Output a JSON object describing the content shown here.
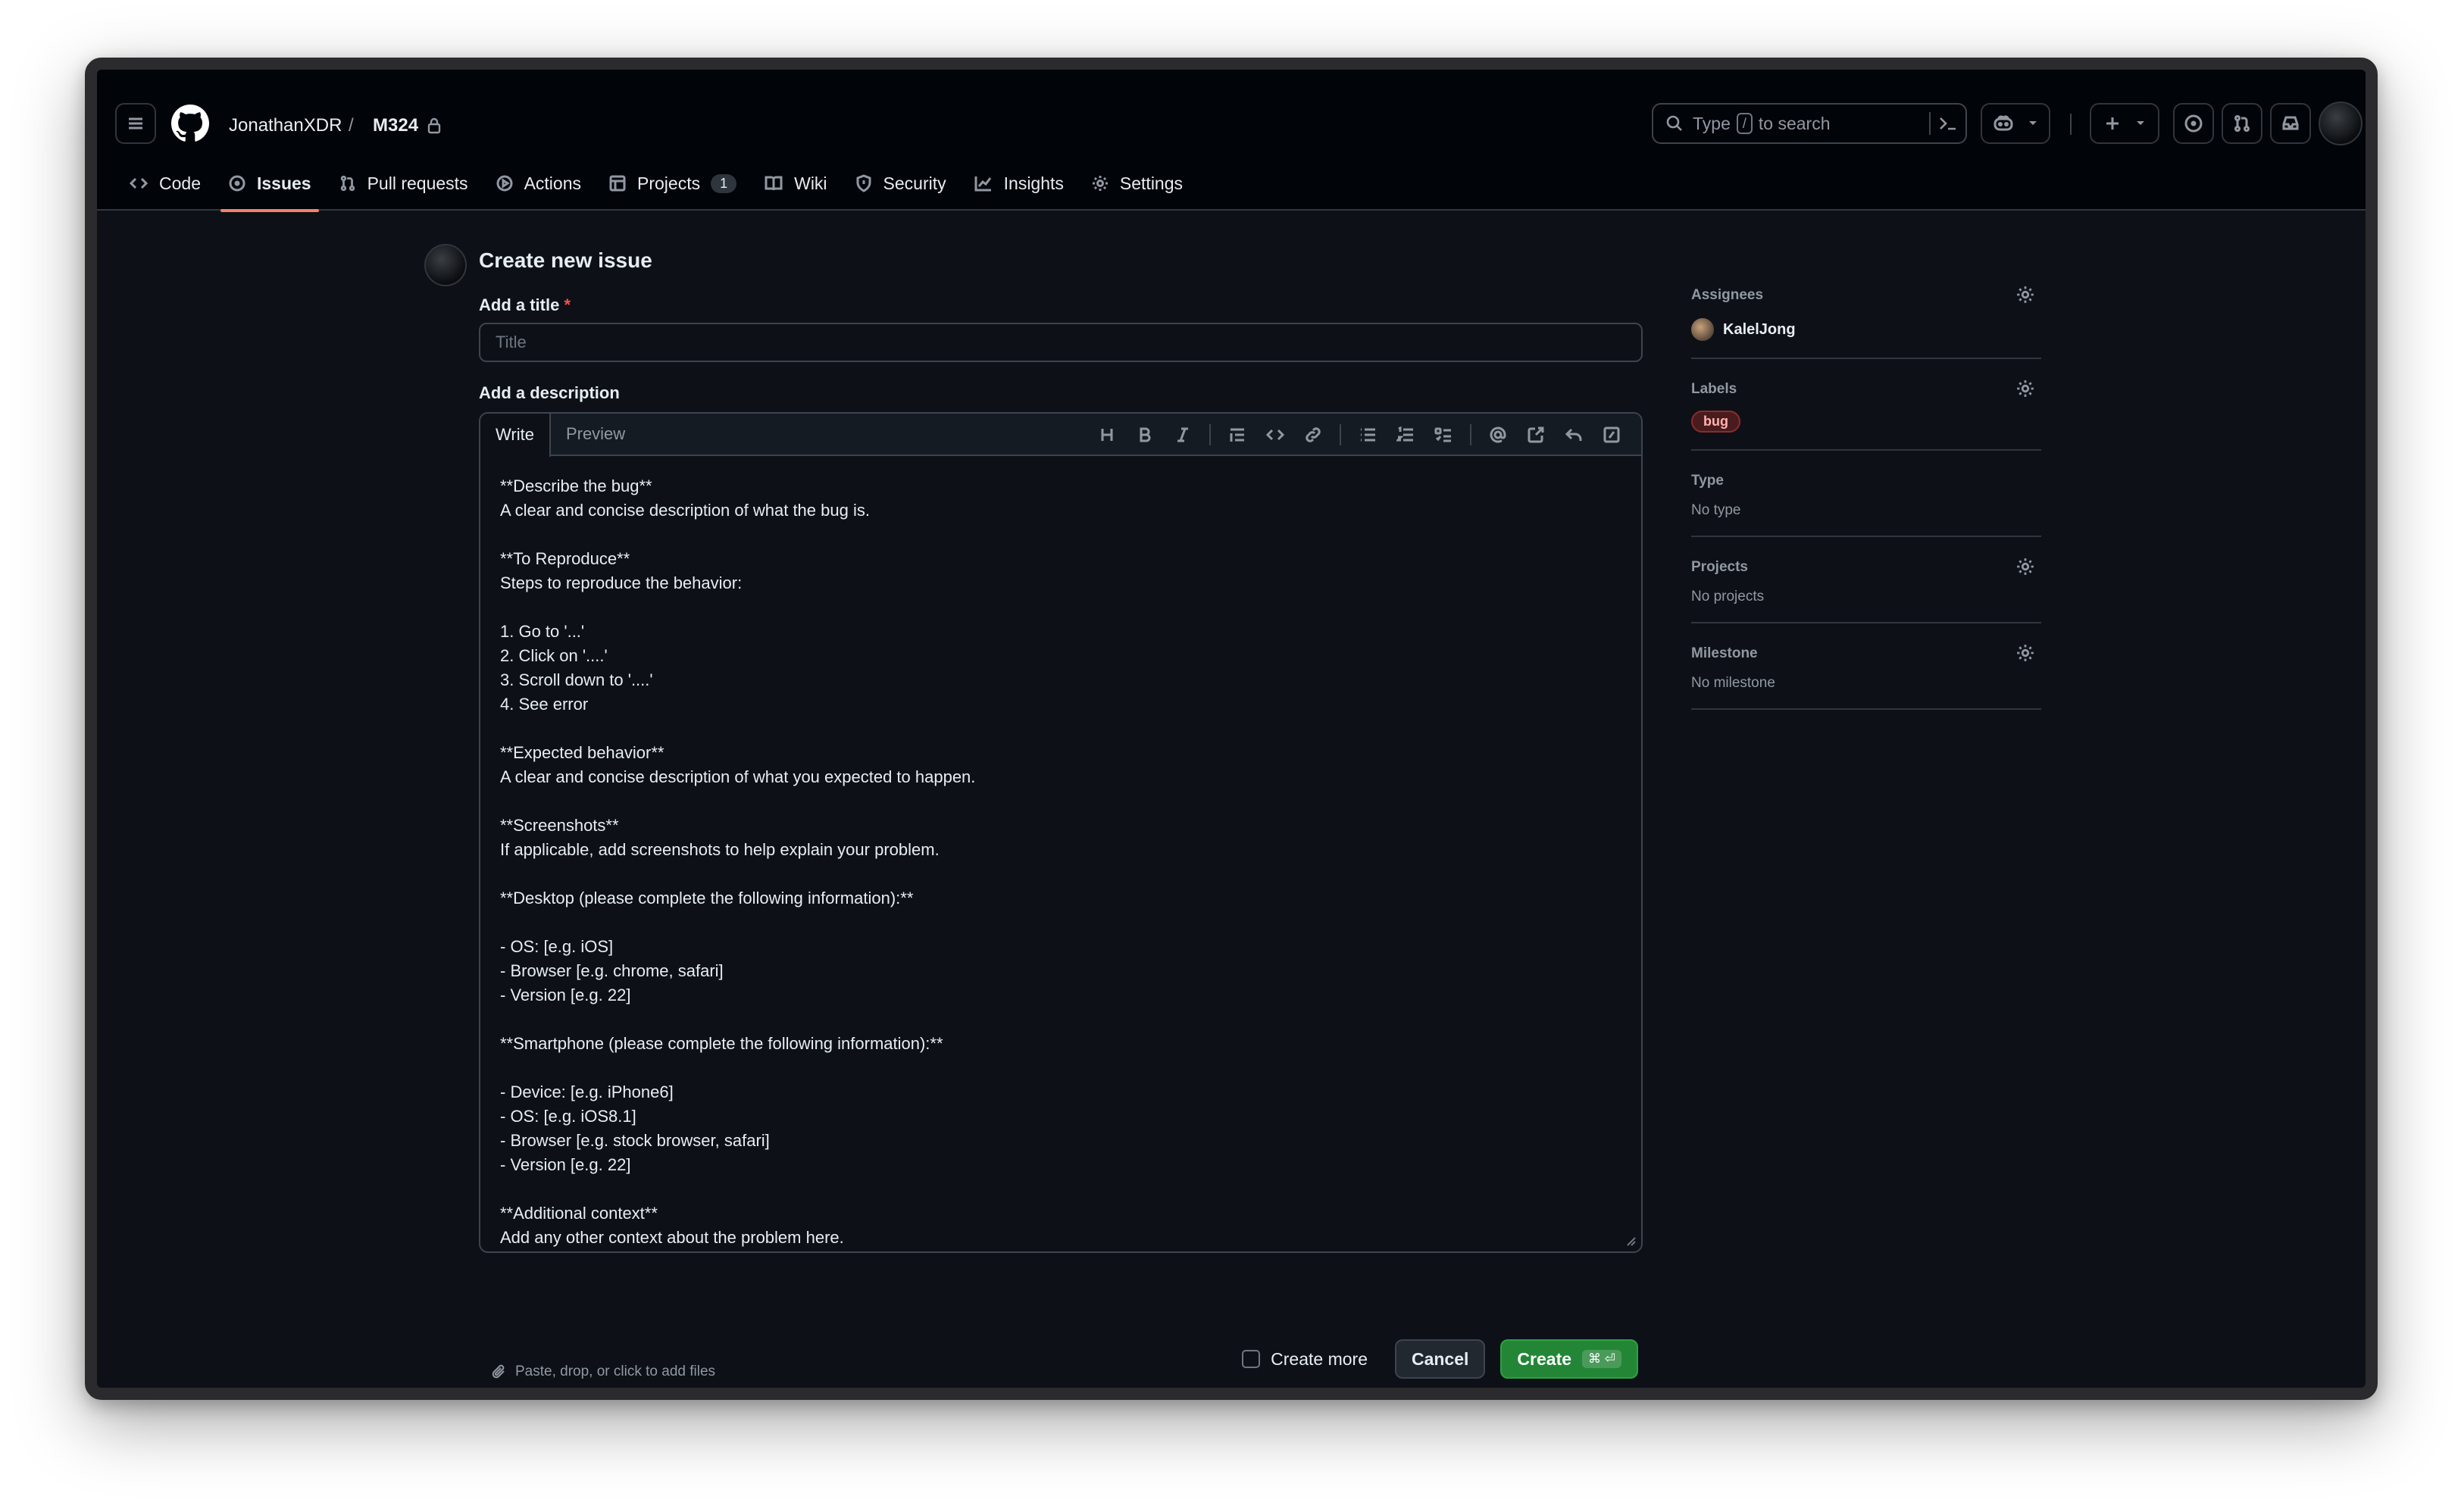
{
  "header": {
    "owner": "JonathanXDR",
    "separator": "/",
    "repo": "M324",
    "search": {
      "prefix": "Type",
      "key": "/",
      "suffix": "to search"
    }
  },
  "nav": {
    "items": [
      {
        "label": "Code",
        "icon": "code-icon"
      },
      {
        "label": "Issues",
        "icon": "issue-opened-icon",
        "active": true
      },
      {
        "label": "Pull requests",
        "icon": "git-pull-request-icon"
      },
      {
        "label": "Actions",
        "icon": "play-icon"
      },
      {
        "label": "Projects",
        "icon": "table-icon",
        "count": "1"
      },
      {
        "label": "Wiki",
        "icon": "book-icon"
      },
      {
        "label": "Security",
        "icon": "shield-icon"
      },
      {
        "label": "Insights",
        "icon": "graph-icon"
      },
      {
        "label": "Settings",
        "icon": "gear-icon"
      }
    ]
  },
  "form": {
    "page_title": "Create new issue",
    "title_label": "Add a title",
    "required_mark": "*",
    "title_placeholder": "Title",
    "description_label": "Add a description",
    "tabs": {
      "write": "Write",
      "preview": "Preview"
    },
    "body": "**Describe the bug**\nA clear and concise description of what the bug is.\n\n**To Reproduce**\nSteps to reproduce the behavior:\n\n1. Go to '...'\n2. Click on '....'\n3. Scroll down to '....'\n4. See error\n\n**Expected behavior**\nA clear and concise description of what you expected to happen.\n\n**Screenshots**\nIf applicable, add screenshots to help explain your problem.\n\n**Desktop (please complete the following information):**\n\n- OS: [e.g. iOS]\n- Browser [e.g. chrome, safari]\n- Version [e.g. 22]\n\n**Smartphone (please complete the following information):**\n\n- Device: [e.g. iPhone6]\n- OS: [e.g. iOS8.1]\n- Browser [e.g. stock browser, safari]\n- Version [e.g. 22]\n\n**Additional context**\nAdd any other context about the problem here.",
    "attach_hint": "Paste, drop, or click to add files",
    "create_more": "Create more",
    "cancel": "Cancel",
    "create": "Create",
    "create_shortcut": "⌘ ⏎"
  },
  "sidebar": {
    "assignees": {
      "title": "Assignees",
      "user": "KalelJong"
    },
    "labels": {
      "title": "Labels",
      "label": "bug"
    },
    "type": {
      "title": "Type",
      "value": "No type"
    },
    "projects": {
      "title": "Projects",
      "value": "No projects"
    },
    "milestone": {
      "title": "Milestone",
      "value": "No milestone"
    }
  },
  "colors": {
    "accent_underline": "#f78166",
    "create_button": "#238636",
    "background": "#0d1117",
    "header_background": "#010409"
  }
}
